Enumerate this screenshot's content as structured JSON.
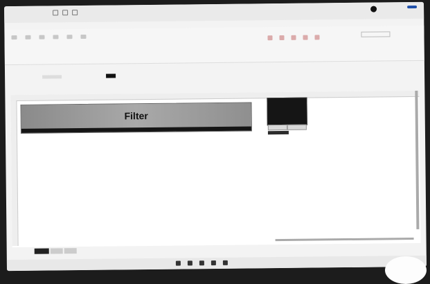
{
  "banner": {
    "title": "Filter"
  },
  "icons": [
    "app-icon",
    "undo-icon",
    "redo-icon",
    "save-icon",
    "share-icon",
    "search-icon",
    "start-icon",
    "taskbar-app-icon",
    "tray-icon"
  ]
}
